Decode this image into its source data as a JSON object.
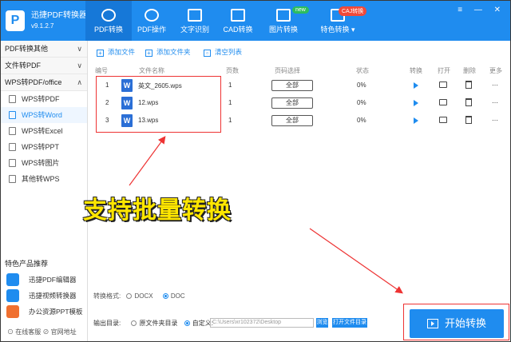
{
  "app": {
    "name": "迅捷PDF转换器",
    "version": "v9.1.2.7",
    "logo_letter": "P"
  },
  "nav": [
    {
      "label": "PDF转换",
      "active": true
    },
    {
      "label": "PDF操作",
      "active": false
    },
    {
      "label": "文字识别",
      "active": false
    },
    {
      "label": "CAD转换",
      "active": false
    },
    {
      "label": "图片转换",
      "active": false
    },
    {
      "label": "特色转换 ▾",
      "active": false
    }
  ],
  "badges": {
    "new": "new",
    "caj": "CAJ转换"
  },
  "window_controls": "≡ — ✕",
  "sidebar": {
    "groups": [
      {
        "label": "PDF转换其他",
        "chev": "∨"
      },
      {
        "label": "文件转PDF",
        "chev": "∨"
      },
      {
        "label": "WPS转PDF/office",
        "chev": "∧"
      }
    ],
    "items": [
      {
        "label": "WPS转PDF",
        "active": false
      },
      {
        "label": "WPS转Word",
        "active": true
      },
      {
        "label": "WPS转Excel",
        "active": false
      },
      {
        "label": "WPS转PPT",
        "active": false
      },
      {
        "label": "WPS转图片",
        "active": false
      },
      {
        "label": "其他转WPS",
        "active": false
      }
    ],
    "recommend_title": "特色产品推荐",
    "recommend": [
      "迅捷PDF编辑器",
      "迅捷视频转换器",
      "办公资源PPT模板"
    ],
    "footer": "⊙ 在线客服   ⊘ 官网地址"
  },
  "toolbar": {
    "add_file": "添加文件",
    "add_folder": "添加文件夹",
    "clear": "清空列表"
  },
  "table": {
    "headers": {
      "num": "编号",
      "name": "文件名称",
      "pages": "页数",
      "range": "页码选择",
      "status": "状态",
      "convert": "转换",
      "open": "打开",
      "delete": "删除",
      "more": "更多"
    },
    "rows": [
      {
        "num": "1",
        "name": "英文_2605.wps",
        "pages": "1",
        "range": "全部",
        "status": "0%"
      },
      {
        "num": "2",
        "name": "12.wps",
        "pages": "1",
        "range": "全部",
        "status": "0%"
      },
      {
        "num": "3",
        "name": "13.wps",
        "pages": "1",
        "range": "全部",
        "status": "0%"
      }
    ],
    "file_icon_letter": "W"
  },
  "overlay_text": "支持批量转换",
  "format": {
    "label": "转换格式:",
    "opt1": "DOCX",
    "opt2": "DOC",
    "selected": "DOC"
  },
  "output": {
    "label": "输出目录:",
    "opt1": "原文件夹目录",
    "opt2": "自定义:",
    "path": "C:\\Users\\xr102372\\Desktop",
    "browse": "浏览",
    "open_folder": "打开文件目录"
  },
  "start_button": "开始转换",
  "colors": {
    "accent": "#1f8cef",
    "highlight": "#ee3333",
    "overlay": "#ffe600"
  }
}
